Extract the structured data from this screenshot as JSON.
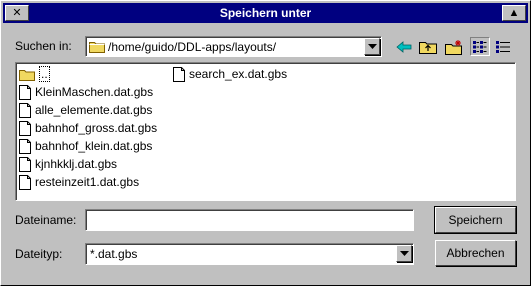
{
  "window": {
    "title": "Speichern unter",
    "close_glyph": "✕",
    "maximize_glyph": "▲"
  },
  "lookin": {
    "label": "Suchen in:",
    "path": "/home/guido/DDL-apps/layouts/"
  },
  "toolbar": {
    "back_icon": "left-arrow-icon",
    "up_icon": "folder-up-icon",
    "new_folder_icon": "new-folder-icon",
    "list_view_icon": "list-view-icon",
    "detail_view_icon": "detail-view-icon"
  },
  "files": {
    "column1": [
      {
        "name": "..",
        "type": "folder"
      },
      {
        "name": "KleinMaschen.dat.gbs",
        "type": "file"
      },
      {
        "name": "alle_elemente.dat.gbs",
        "type": "file"
      },
      {
        "name": "bahnhof_gross.dat.gbs",
        "type": "file"
      },
      {
        "name": "bahnhof_klein.dat.gbs",
        "type": "file"
      },
      {
        "name": "kjnhkklj.dat.gbs",
        "type": "file"
      },
      {
        "name": "resteinzeit1.dat.gbs",
        "type": "file"
      }
    ],
    "column2": [
      {
        "name": "search_ex.dat.gbs",
        "type": "file"
      }
    ]
  },
  "filename": {
    "label": "Dateiname:",
    "value": ""
  },
  "filetype": {
    "label": "Dateityp:",
    "value": "*.dat.gbs"
  },
  "buttons": {
    "save": "Speichern",
    "cancel": "Abbrechen"
  },
  "colors": {
    "titlebar": "#000080",
    "face": "#c0c0c0",
    "folder": "#f0d860"
  }
}
